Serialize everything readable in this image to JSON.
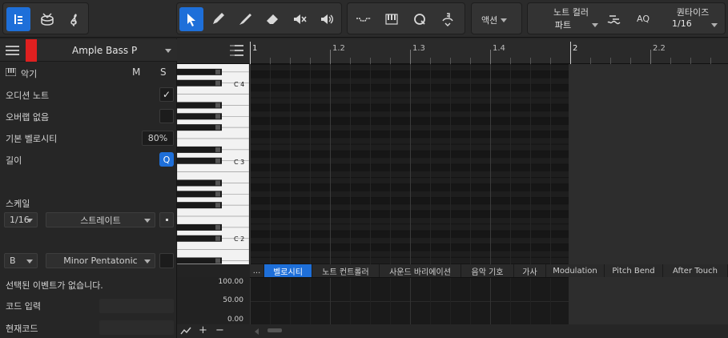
{
  "colors": {
    "accent": "#1e6fd9",
    "track_color": "#e02020"
  },
  "toolbar": {
    "left_icons": [
      "note-edit-icon",
      "drum-icon",
      "treble-clef-icon"
    ],
    "tool_icons": [
      "arrow-icon",
      "pencil-icon",
      "paint-icon",
      "eraser-icon",
      "mute-icon",
      "speaker-icon"
    ],
    "view_icons": [
      "automation-icon",
      "piano-icon",
      "quantize-icon",
      "transpose-icon"
    ],
    "action_label": "액션",
    "note_color_label": "노트 컬러",
    "note_color_value": "파트",
    "aq_label": "AQ",
    "quantize_label": "퀀타이즈",
    "quantize_value": "1/16"
  },
  "inspector": {
    "track_name": "Ample Bass P",
    "instrument_label": "악기",
    "m_label": "M",
    "s_label": "S",
    "audition_label": "오디션 노트",
    "audition_check": "✓",
    "overlap_label": "오버랩 없음",
    "velocity_label": "기본 벨로시티",
    "velocity_value": "80%",
    "length_label": "길이",
    "length_q": "Q",
    "length_value": "1/16",
    "length_mode": "스트레이트",
    "scale_label": "스케일",
    "scale_root": "B",
    "scale_type": "Minor Pentatonic",
    "no_selection": "선택된 이벤트가 없습니다.",
    "chord_input_label": "코드 입력",
    "current_chord_label": "현재코드"
  },
  "ruler": {
    "marks": [
      "1",
      "1.2",
      "1.3",
      "1.4",
      "2",
      "2.2"
    ]
  },
  "keys": {
    "labels": [
      "C 4",
      "C 3",
      "C 2"
    ]
  },
  "tabs": {
    "more": "...",
    "items": [
      "벨로시티",
      "노트 컨트롤러",
      "사운드 바리에이션",
      "음악 기호",
      "가사",
      "Modulation",
      "Pitch Bend",
      "After Touch"
    ]
  },
  "velocity_axis": {
    "ticks": [
      "100.00",
      "50.00",
      "0.00"
    ]
  },
  "bottom": {
    "icons": [
      "line-tool-icon",
      "add-icon",
      "remove-icon"
    ]
  }
}
